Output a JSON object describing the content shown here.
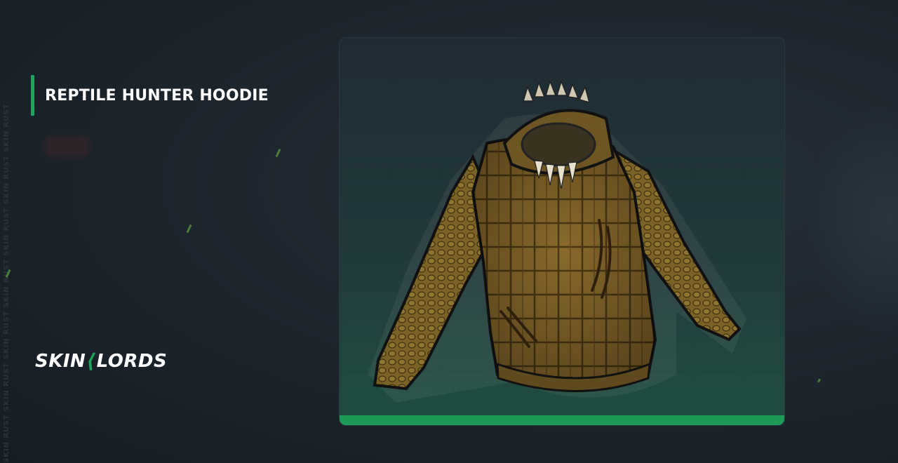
{
  "item": {
    "title": "REPTILE HUNTER HOODIE"
  },
  "brand": {
    "logo_left": "SKIN",
    "logo_right": "LORDS",
    "watermark": "SKIN RUST SKIN RUST SKIN RUST SKIN RUST SKIN RUST SKIN RUST SKIN RUST"
  },
  "colors": {
    "accent": "#1fa45c",
    "background": "#1c242c",
    "card_bar": "#1d9a57"
  },
  "icons": {
    "item_image": "hoodie-image",
    "logo_mark": "claw-icon"
  }
}
